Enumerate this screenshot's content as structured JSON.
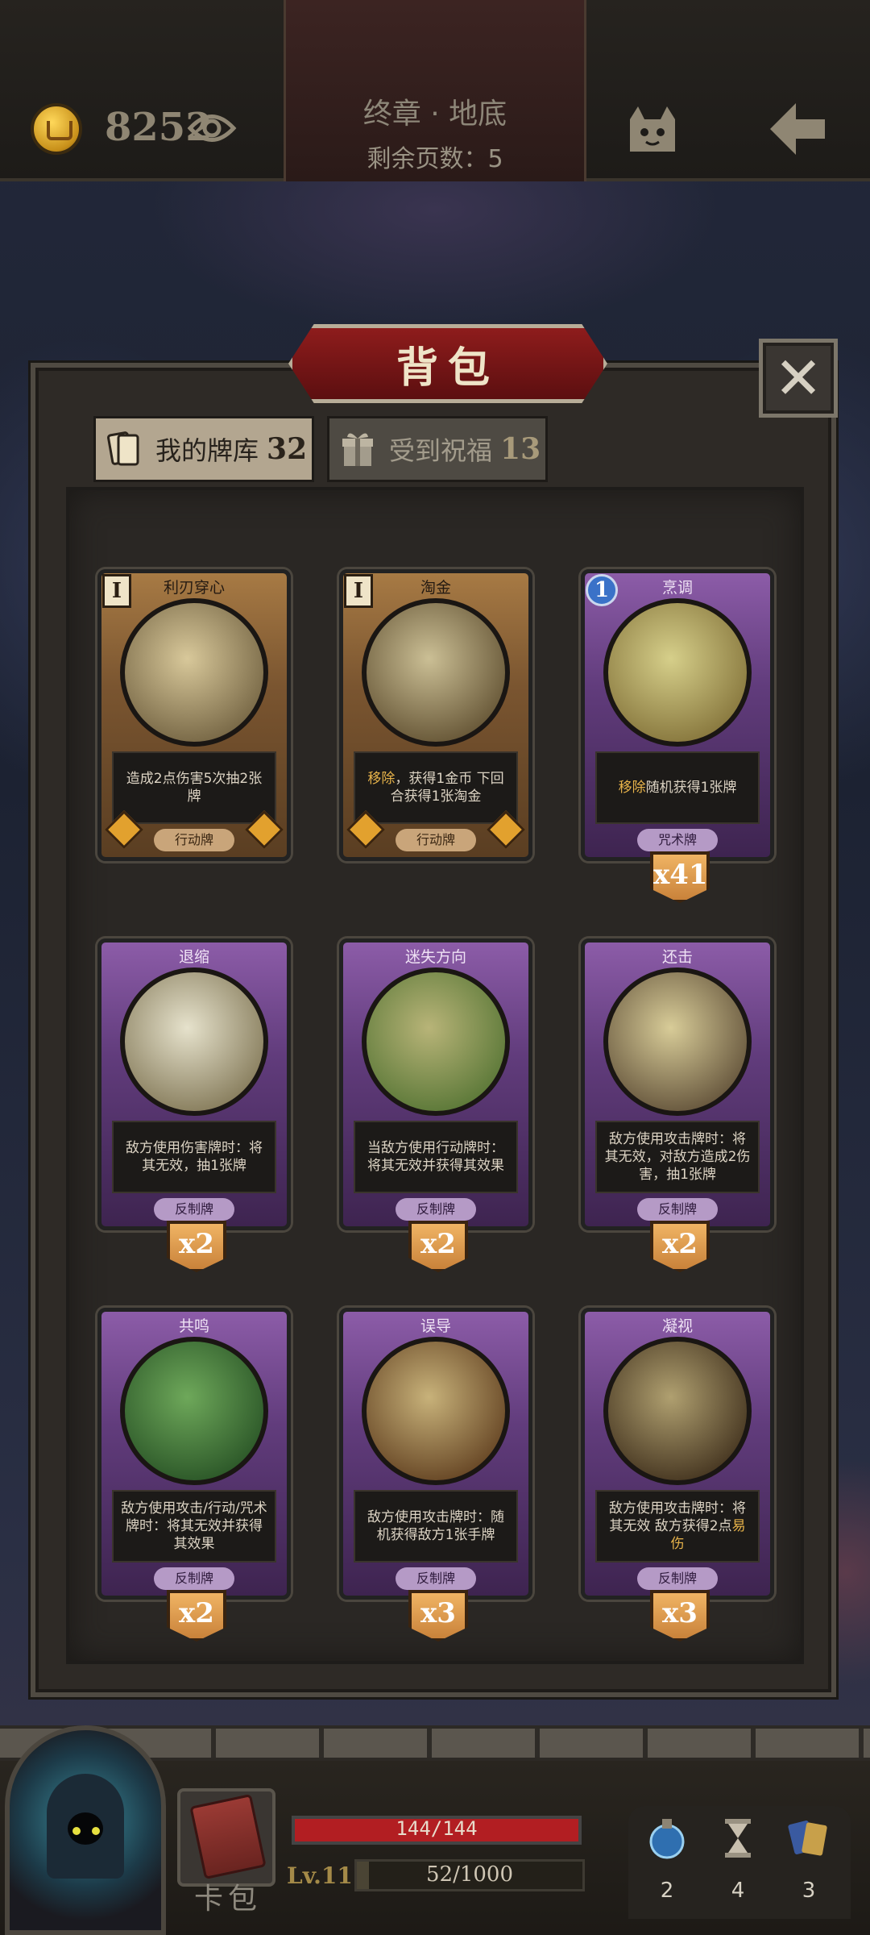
{
  "header": {
    "gold": "8252",
    "chapter": "终章 · 地底",
    "pages_left": "剩余页数：5",
    "icons": [
      "coin-icon",
      "eye-icon",
      "cat-icon",
      "back-arrow-icon"
    ]
  },
  "panel": {
    "title": "背包",
    "close_icon": "close-icon",
    "tabs": [
      {
        "label": "我的牌库",
        "count": "32",
        "icon": "cards-icon",
        "active": true
      },
      {
        "label": "受到祝福",
        "count": "13",
        "icon": "gift-icon",
        "active": false
      }
    ]
  },
  "cards": [
    {
      "name": "利刃穿心",
      "cost": "I",
      "category": "action",
      "type": "行动牌",
      "desc_pre": "造成2点伤害5次",
      "desc_hl": "",
      "desc_post": "抽2张牌",
      "count": "",
      "art": "red-hood-skull-art"
    },
    {
      "name": "淘金",
      "cost": "I",
      "category": "action",
      "type": "行动牌",
      "desc_pre": "",
      "desc_hl": "移除",
      "desc_post": "，获得1金币 下回合获得1张淘金",
      "count": "",
      "art": "gold-pan-art"
    },
    {
      "name": "烹调",
      "cost": "1",
      "category": "spell",
      "type": "咒术牌",
      "desc_pre": "",
      "desc_hl": "移除",
      "desc_post": "随机获得1张牌",
      "count": "x41",
      "art": "fox-chef-art"
    },
    {
      "name": "退缩",
      "cost": "",
      "category": "counter",
      "type": "反制牌",
      "desc_pre": "敌方使用伤害牌时：将其无效，抽1张牌",
      "desc_hl": "",
      "desc_post": "",
      "count": "x2",
      "art": "retreat-art"
    },
    {
      "name": "迷失方向",
      "cost": "",
      "category": "counter",
      "type": "反制牌",
      "desc_pre": "当敌方使用行动牌时：将其无效并获得其效果",
      "desc_hl": "",
      "desc_post": "",
      "count": "x2",
      "art": "signpost-art"
    },
    {
      "name": "还击",
      "cost": "",
      "category": "counter",
      "type": "反制牌",
      "desc_pre": "敌方使用攻击牌时：将其无效，对敌方造成2伤害，抽1张牌",
      "desc_hl": "",
      "desc_post": "",
      "count": "x2",
      "art": "dwarf-axe-art"
    },
    {
      "name": "共鸣",
      "cost": "",
      "category": "counter",
      "type": "反制牌",
      "desc_pre": "敌方使用攻击/行动/咒术牌时：将其无效并获得其效果",
      "desc_hl": "",
      "desc_post": "",
      "count": "x2",
      "art": "green-skulls-art"
    },
    {
      "name": "误导",
      "cost": "",
      "category": "counter",
      "type": "反制牌",
      "desc_pre": "敌方使用攻击牌时：随机获得敌方1张手牌",
      "desc_hl": "",
      "desc_post": "",
      "count": "x3",
      "art": "skull-target-art"
    },
    {
      "name": "凝视",
      "cost": "",
      "category": "counter",
      "type": "反制牌",
      "desc_pre": "敌方使用攻击牌时：将其无效 敌方获得2点",
      "desc_hl": "易伤",
      "desc_post": "",
      "count": "x3",
      "art": "owl-art"
    }
  ],
  "hud": {
    "hp": "144/144",
    "hp_fraction": 1.0,
    "level": "Lv.11",
    "xp": "52/1000",
    "xp_fraction": 0.052,
    "book_label": "卡包",
    "resources": [
      {
        "icon": "potion-icon",
        "value": "2"
      },
      {
        "icon": "hourglass-icon",
        "value": "4"
      },
      {
        "icon": "cards-stack-icon",
        "value": "3"
      }
    ]
  },
  "colors": {
    "banner_red": "#8e1c1c",
    "action_card": "#a77a44",
    "counter_card": "#8c5ca8",
    "highlight": "#e7b34a",
    "hp_red": "#b21e22"
  }
}
